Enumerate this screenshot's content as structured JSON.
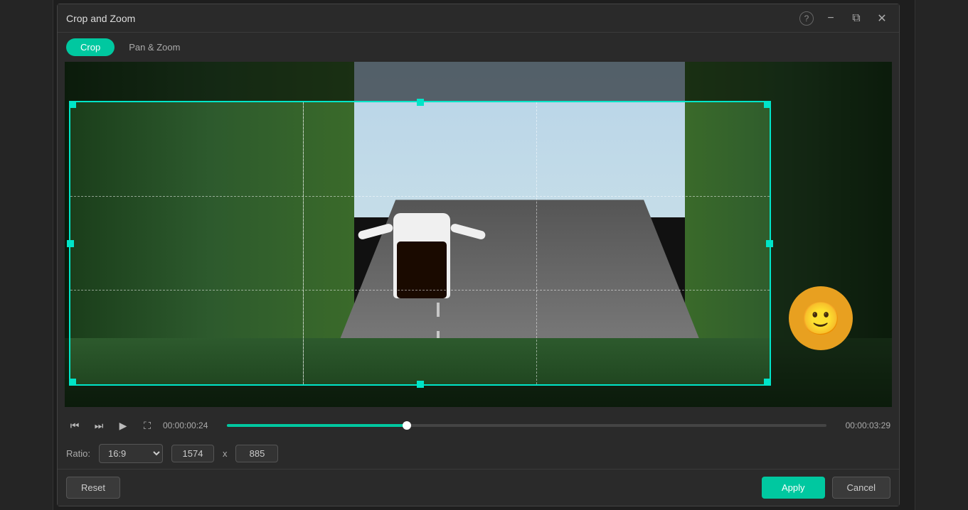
{
  "app": {
    "title": "Crop and Zoom"
  },
  "titlebar": {
    "title": "Crop and Zoom",
    "help_label": "?",
    "minimize_label": "−",
    "maximize_label": "⧉",
    "close_label": "✕"
  },
  "tabs": [
    {
      "id": "crop",
      "label": "Crop",
      "active": true
    },
    {
      "id": "pan_zoom",
      "label": "Pan & Zoom",
      "active": false
    }
  ],
  "playback": {
    "time_current": "00:00:00:24",
    "time_end": "00:00:03:29"
  },
  "ratio": {
    "label": "Ratio:",
    "value": "16:9",
    "width": "1574",
    "height": "885",
    "separator": "x"
  },
  "actions": {
    "reset_label": "Reset",
    "apply_label": "Apply",
    "cancel_label": "Cancel"
  },
  "smiley": "🙂",
  "colors": {
    "accent": "#00c8a0",
    "crop_border": "#00e5c8"
  }
}
